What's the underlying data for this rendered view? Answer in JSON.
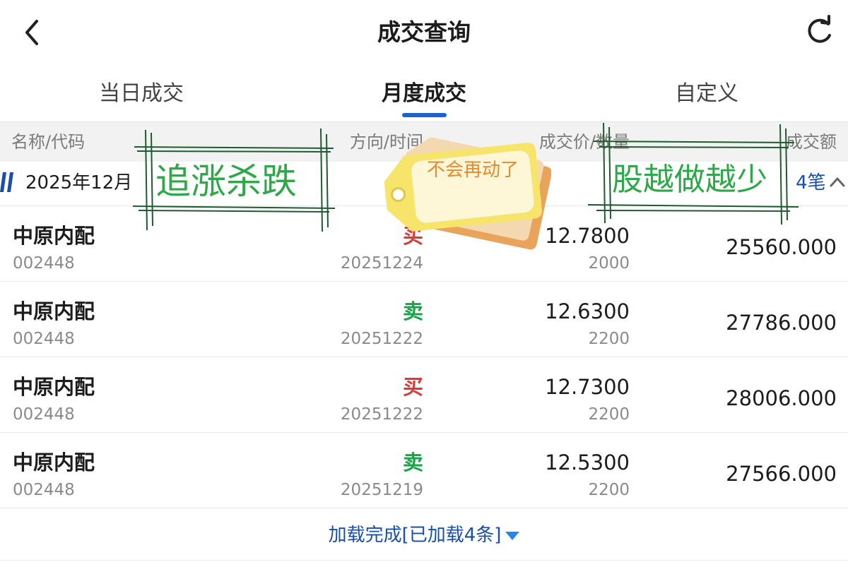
{
  "header": {
    "title": "成交查询",
    "back_icon": "chevron-left-icon",
    "refresh_icon": "refresh-icon"
  },
  "tabs": [
    {
      "label": "当日成交",
      "active": false
    },
    {
      "label": "月度成交",
      "active": true
    },
    {
      "label": "自定义",
      "active": false
    }
  ],
  "columns": {
    "name": "名称/代码",
    "direction": "方向/时间",
    "price": "成交价/数量",
    "amount": "成交额"
  },
  "group": {
    "label": "2025年12月",
    "count": "4笔",
    "expanded": true
  },
  "rows": [
    {
      "name": "中原内配",
      "code": "002448",
      "direction": "买",
      "date": "20251224",
      "price": "12.7800",
      "qty": "2000",
      "amount": "25560.000"
    },
    {
      "name": "中原内配",
      "code": "002448",
      "direction": "卖",
      "date": "20251222",
      "price": "12.6300",
      "qty": "2200",
      "amount": "27786.000"
    },
    {
      "name": "中原内配",
      "code": "002448",
      "direction": "买",
      "date": "20251222",
      "price": "12.7300",
      "qty": "2200",
      "amount": "28006.000"
    },
    {
      "name": "中原内配",
      "code": "002448",
      "direction": "卖",
      "date": "20251219",
      "price": "12.5300",
      "qty": "2200",
      "amount": "27566.000"
    }
  ],
  "footer": {
    "load_status": "加载完成[已加载4条]"
  },
  "stickers": {
    "left": "追涨杀跌",
    "tag": "不会再动了",
    "right": "股越做越少"
  },
  "colors": {
    "buy": "#d93b3b",
    "sell": "#1aa34a",
    "accent": "#1a63d6",
    "sticker_green": "#2fa84a",
    "tag_yellow": "#f7e46a",
    "tag_orange": "#e48a2f"
  }
}
